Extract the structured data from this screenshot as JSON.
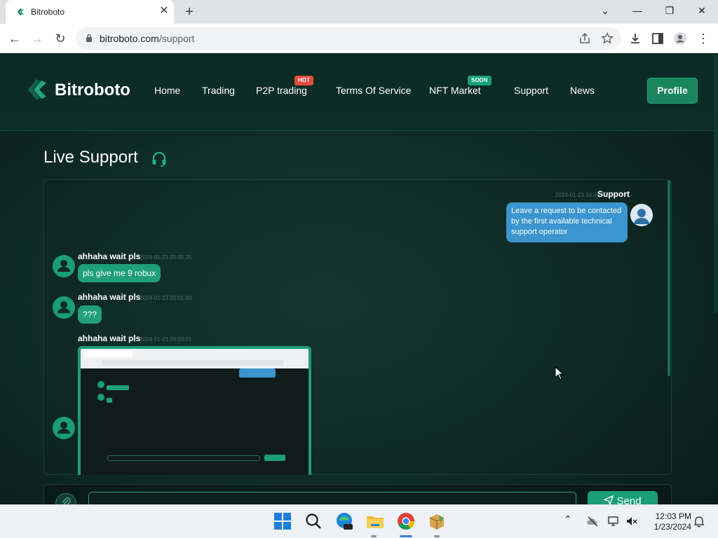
{
  "browser": {
    "tab_title": "Bitroboto",
    "url_host": "bitroboto.com",
    "url_path": "/support"
  },
  "site": {
    "logo_text": "Bitroboto",
    "nav": [
      {
        "label": "Home"
      },
      {
        "label": "Trading"
      },
      {
        "label": "P2P trading",
        "badge": "HOT"
      },
      {
        "label": "Terms Of Service"
      },
      {
        "label": "NFT Market",
        "badge": "SOON"
      },
      {
        "label": "Support"
      },
      {
        "label": "News"
      }
    ],
    "profile_label": "Profile",
    "colors": {
      "accent": "#1b9d76",
      "hot": "#e74c3c",
      "support_bubble": "#3b95cf"
    }
  },
  "chat": {
    "title": "Live Support",
    "messages": [
      {
        "author": "Support",
        "time": "2024-01-23 19:49",
        "text": "Leave a request to be contacted by the first available technical support operator",
        "side": "right"
      },
      {
        "author": "ahhaha wait pls",
        "time": "2024-01-23 20:00:25",
        "text": "pls give me 9 robux",
        "side": "left"
      },
      {
        "author": "ahhaha wait pls",
        "time": "2024-01-23 20:01:40",
        "text": "???",
        "side": "left"
      },
      {
        "author": "ahhaha wait pls",
        "time": "2024-01-23 20:03:01",
        "text": "",
        "side": "left",
        "attachment": "screenshot"
      }
    ],
    "send_label": "Send"
  },
  "taskbar": {
    "time": "12:03 PM",
    "date": "1/23/2024"
  }
}
